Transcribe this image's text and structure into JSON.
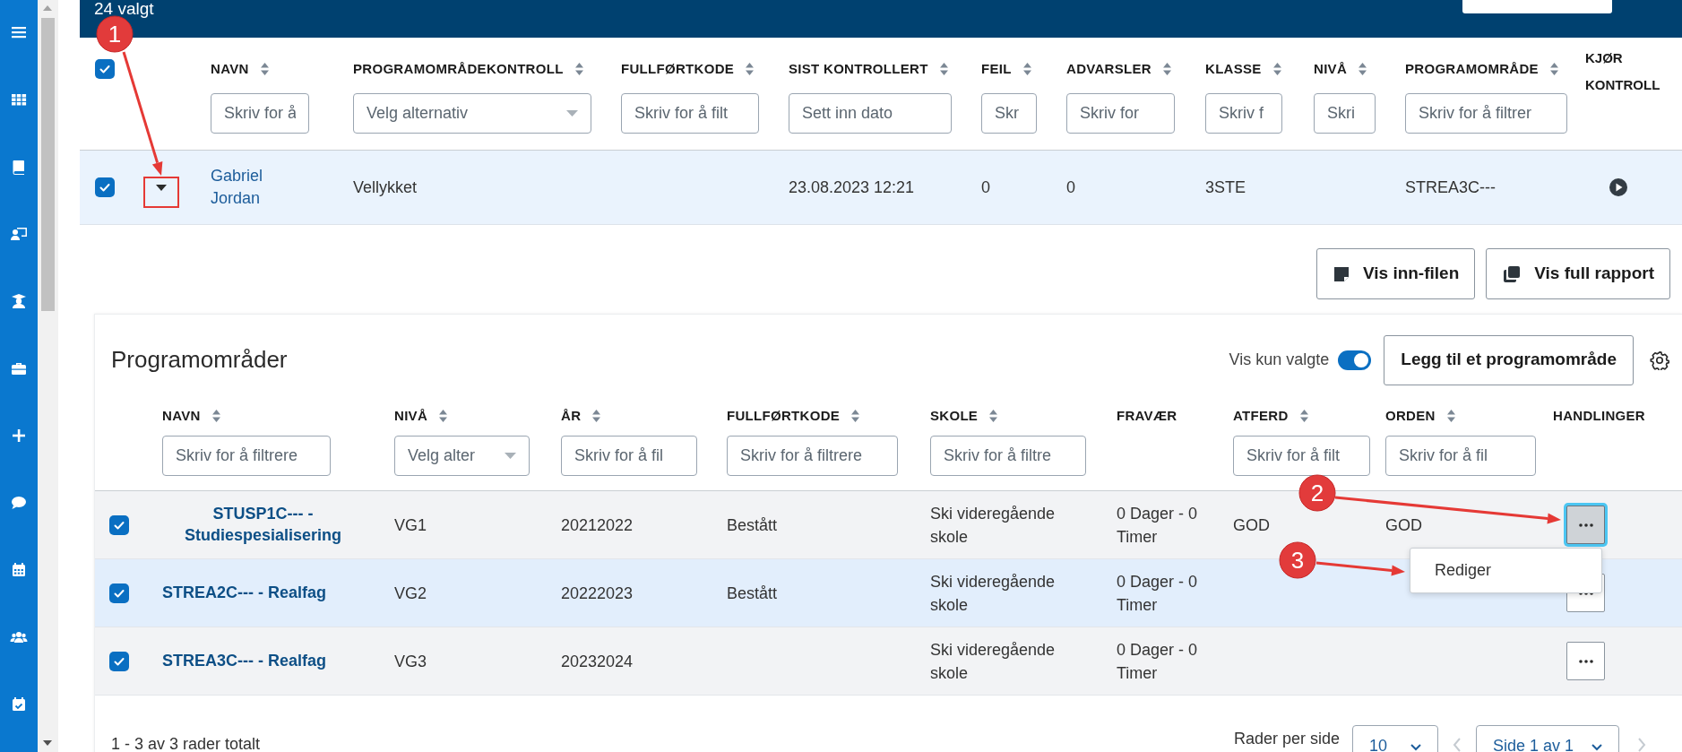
{
  "header": {
    "selected_count": "24 valgt"
  },
  "students_table": {
    "select_all_checked": true,
    "columns": [
      {
        "label": "NAVN",
        "sortable": true,
        "filter": {
          "kind": "text",
          "placeholder": "Skriv for å"
        }
      },
      {
        "label": "PROGRAMOMRÅDEKONTROLL",
        "sortable": true,
        "filter": {
          "kind": "select",
          "placeholder": "Velg alternativ"
        }
      },
      {
        "label": "FULLFØRTKODE",
        "sortable": true,
        "filter": {
          "kind": "text",
          "placeholder": "Skriv for å filt"
        }
      },
      {
        "label": "SIST KONTROLLERT",
        "sortable": true,
        "filter": {
          "kind": "text",
          "placeholder": "Sett inn dato"
        }
      },
      {
        "label": "FEIL",
        "sortable": true,
        "filter": {
          "kind": "text",
          "placeholder": "Skr"
        }
      },
      {
        "label": "ADVARSLER",
        "sortable": true,
        "filter": {
          "kind": "text",
          "placeholder": "Skriv for"
        }
      },
      {
        "label": "KLASSE",
        "sortable": true,
        "filter": {
          "kind": "text",
          "placeholder": "Skriv f"
        }
      },
      {
        "label": "NIVÅ",
        "sortable": true,
        "filter": {
          "kind": "text",
          "placeholder": "Skri"
        }
      },
      {
        "label": "PROGRAMOMRÅDE",
        "sortable": true,
        "filter": {
          "kind": "text",
          "placeholder": "Skriv for å filtrer"
        }
      },
      {
        "label": "KJØR KONTROLL",
        "sortable": false
      }
    ],
    "rows": [
      {
        "checked": true,
        "expanded": true,
        "cells": [
          "Gabriel Jordan",
          "Vellykket",
          null,
          "23.08.2023 12:21",
          "0",
          "0",
          "3STE",
          null,
          "STREA3C---"
        ]
      }
    ]
  },
  "report_buttons": [
    {
      "kind": "file",
      "label": "Vis inn-filen"
    },
    {
      "kind": "copy",
      "label": "Vis full rapport"
    }
  ],
  "programs": {
    "title": "Programområder",
    "only_selected": {
      "label": "Vis kun valgte",
      "on": true
    },
    "add_button": "Legg til et programområde",
    "columns": [
      {
        "label": "NAVN",
        "sortable": true,
        "filter": {
          "kind": "text",
          "placeholder": "Skriv for å filtrere"
        }
      },
      {
        "label": "NIVÅ",
        "sortable": true,
        "filter": {
          "kind": "select",
          "placeholder": "Velg alter"
        }
      },
      {
        "label": "ÅR",
        "sortable": true,
        "filter": {
          "kind": "text",
          "placeholder": "Skriv for å fil"
        }
      },
      {
        "label": "FULLFØRTKODE",
        "sortable": true,
        "filter": {
          "kind": "text",
          "placeholder": "Skriv for å filtrere"
        }
      },
      {
        "label": "SKOLE",
        "sortable": true,
        "filter": {
          "kind": "text",
          "placeholder": "Skriv for å filtre"
        }
      },
      {
        "label": "FRAVÆR",
        "sortable": false
      },
      {
        "label": "ATFERD",
        "sortable": true,
        "filter": {
          "kind": "text",
          "placeholder": "Skriv for å filt"
        }
      },
      {
        "label": "ORDEN",
        "sortable": true,
        "filter": {
          "kind": "text",
          "placeholder": "Skriv for å fil"
        }
      },
      {
        "label": "HANDLINGER",
        "sortable": false
      }
    ],
    "rows": [
      {
        "checked": true,
        "highlighted": false,
        "menu_open": true,
        "cells": [
          "STUSP1C--- - Studiespesialisering",
          "VG1",
          "20212022",
          "Bestått",
          "Ski videregående skole",
          "0 Dager - 0 Timer",
          "GOD",
          "GOD"
        ],
        "menu_items": [
          "Rediger"
        ]
      },
      {
        "checked": true,
        "highlighted": true,
        "menu_open": false,
        "cells": [
          "STREA2C--- - Realfag",
          "VG2",
          "20222023",
          "Bestått",
          "Ski videregående skole",
          "0 Dager - 0 Timer",
          null,
          null
        ]
      },
      {
        "checked": true,
        "highlighted": false,
        "menu_open": false,
        "cells": [
          "STREA3C--- - Realfag",
          "VG3",
          "20232024",
          null,
          "Ski videregående skole",
          "0 Dager - 0 Timer",
          null,
          null
        ]
      }
    ],
    "pagination": {
      "summary": "1 - 3 av 3 rader totalt",
      "rows_per_page_label": "Rader per side",
      "rows_per_page": "10",
      "page": "Side 1 av 1"
    }
  },
  "annotations": [
    {
      "kind": "callout",
      "number": "1"
    },
    {
      "kind": "frame"
    },
    {
      "kind": "callout",
      "number": "2"
    },
    {
      "kind": "callout",
      "number": "3"
    }
  ]
}
